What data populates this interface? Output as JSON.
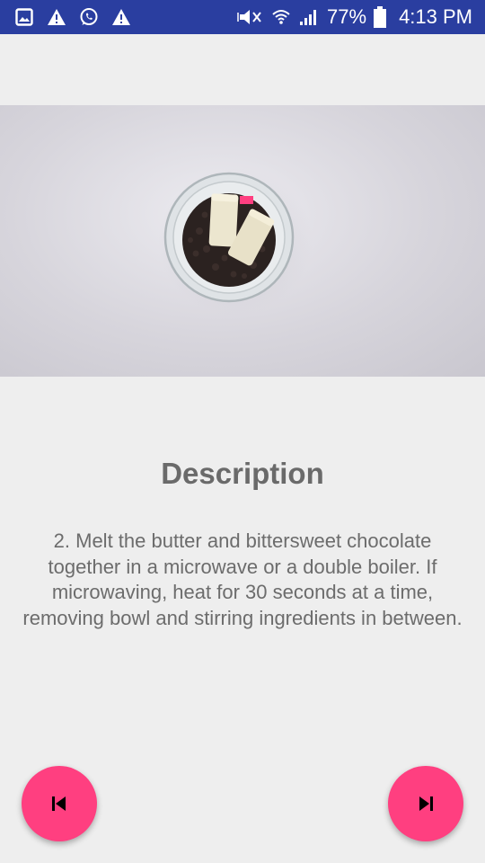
{
  "status_bar": {
    "battery": "77%",
    "time": "4:13 PM",
    "left_icons": [
      "image-icon",
      "warning-icon",
      "whatsapp-icon",
      "warning-icon"
    ],
    "right_icons": [
      "vibrate-mute-icon",
      "wifi-icon",
      "signal-icon",
      "battery-icon"
    ]
  },
  "step_image": {
    "description": ""
  },
  "description": {
    "title": "Description",
    "text": "2. Melt the butter and bittersweet chocolate together in a microwave or a double boiler. If microwaving, heat for 30 seconds at a time, removing bowl and stirring ingredients in between."
  },
  "navigation": {
    "prev_icon": "skip-previous-icon",
    "next_icon": "skip-next-icon"
  },
  "colors": {
    "status_bar": "#2a3ea0",
    "background": "#eeeeee",
    "accent": "#ff3f80",
    "text": "#6c6c6c"
  }
}
